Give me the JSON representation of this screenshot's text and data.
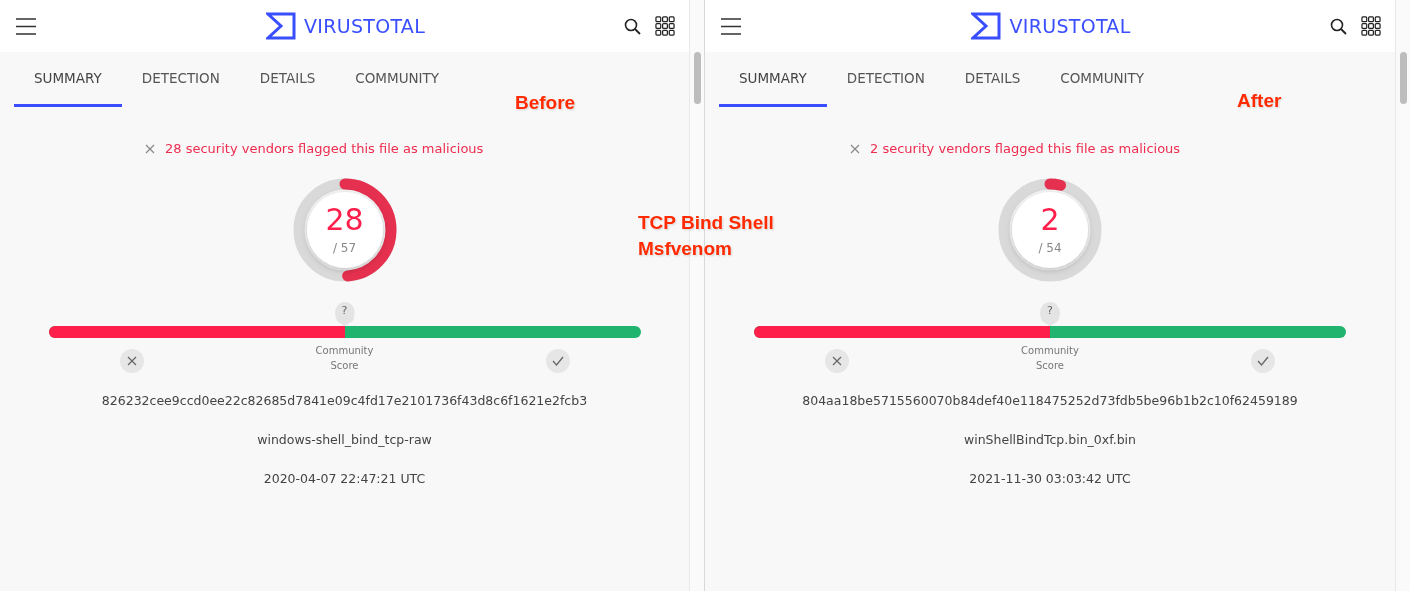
{
  "panels": [
    {
      "logo_text": "VIRUSTOTAL",
      "annotation": "Before",
      "tabs": [
        {
          "label": "SUMMARY",
          "selected": true
        },
        {
          "label": "DETECTION",
          "selected": false
        },
        {
          "label": "DETAILS",
          "selected": false
        },
        {
          "label": "COMMUNITY",
          "selected": false
        }
      ],
      "alert": "28 security vendors flagged this file as malicious",
      "gauge": {
        "count": "28",
        "total": "/ 57",
        "level": 0.49
      },
      "community": {
        "help_mark": "?",
        "level": 0.5,
        "label": "Community Score"
      },
      "hash": "826232cee9ccd0ee22c82685d7841e09c4fd17e2101736f43d8c6f1621e2fcb3",
      "file_name": "windows-shell_bind_tcp-raw",
      "date": "2020-04-07 22:47:21 UTC"
    },
    {
      "logo_text": "VIRUSTOTAL",
      "annotation": "After",
      "tabs": [
        {
          "label": "SUMMARY",
          "selected": true
        },
        {
          "label": "DETECTION",
          "selected": false
        },
        {
          "label": "DETAILS",
          "selected": false
        },
        {
          "label": "COMMUNITY",
          "selected": false
        }
      ],
      "alert": "2 security vendors flagged this file as malicious",
      "gauge": {
        "count": "2",
        "total": "/ 54",
        "level": 0.037
      },
      "community": {
        "help_mark": "?",
        "level": 0.5,
        "label": "Community Score"
      },
      "hash": "804aa18be5715560070b84def40e118475252d73fdb5be96b1b2c10f62459189",
      "file_name": "winShellBindTcp.bin_0xf.bin",
      "date": "2021-11-30 03:03:42 UTC"
    }
  ],
  "center_note": {
    "line_1": "TCP Bind Shell",
    "line_2": "Msfvenom"
  }
}
